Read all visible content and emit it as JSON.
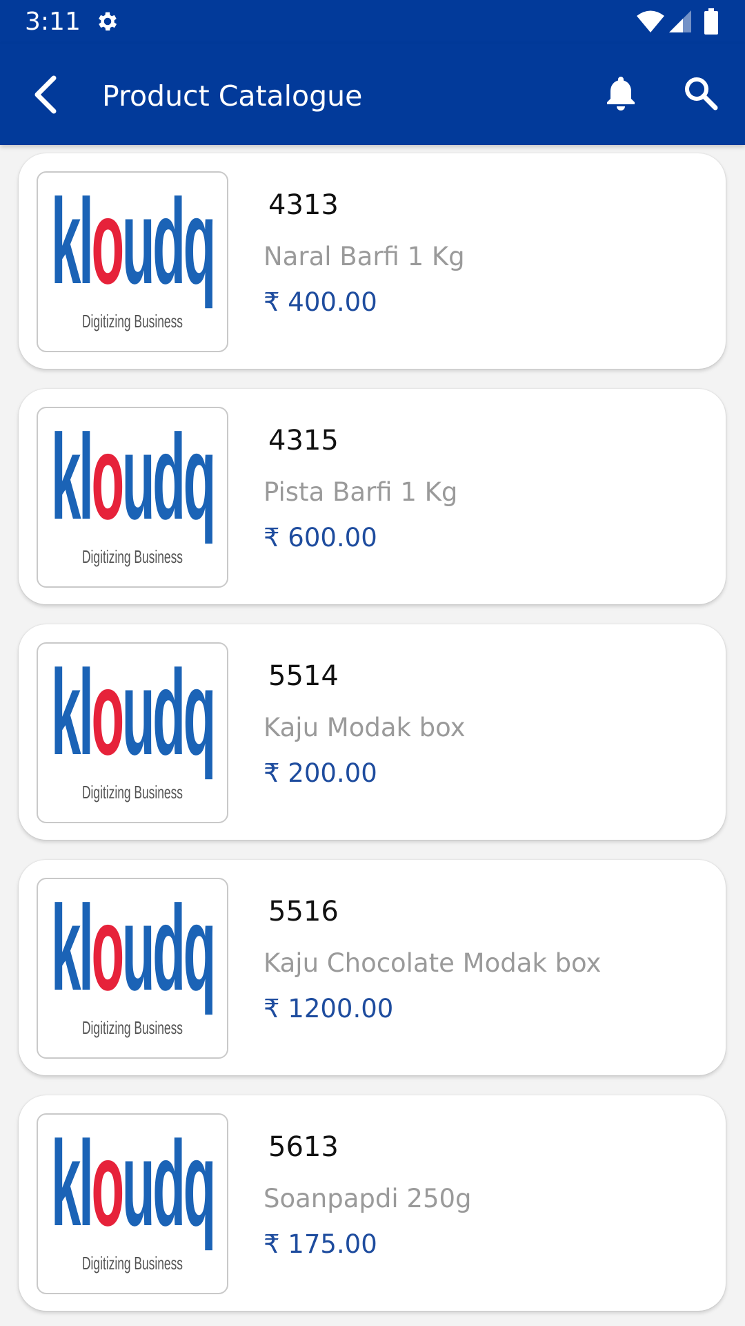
{
  "colors": {
    "primary": "#023a9a",
    "price": "#1e4c9e",
    "name": "#9a9a9a",
    "logo_blue": "#1b63b6",
    "logo_red": "#e6223a"
  },
  "status_bar": {
    "time": "3:11",
    "icons": [
      "gear-icon",
      "wifi-icon",
      "signal-icon",
      "battery-icon"
    ]
  },
  "app_bar": {
    "title": "Product Catalogue",
    "icons": [
      "back-arrow-icon",
      "bell-icon",
      "search-icon"
    ]
  },
  "products": [
    {
      "code": "4313",
      "name": "Naral Barfi 1 Kg",
      "price": "₹ 400.00",
      "logo_text": "kloudq",
      "logo_tagline": "Digitizing Business"
    },
    {
      "code": "4315",
      "name": "Pista Barfi 1 Kg",
      "price": "₹ 600.00",
      "logo_text": "kloudq",
      "logo_tagline": "Digitizing Business"
    },
    {
      "code": "5514",
      "name": "Kaju Modak box",
      "price": "₹ 200.00",
      "logo_text": "kloudq",
      "logo_tagline": "Digitizing Business"
    },
    {
      "code": "5516",
      "name": "Kaju Chocolate Modak box",
      "price": "₹ 1200.00",
      "logo_text": "kloudq",
      "logo_tagline": "Digitizing Business"
    },
    {
      "code": "5613",
      "name": "Soanpapdi 250g",
      "price": "₹ 175.00",
      "logo_text": "kloudq",
      "logo_tagline": "Digitizing Business"
    }
  ]
}
